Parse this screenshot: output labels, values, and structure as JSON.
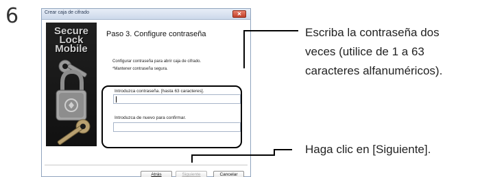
{
  "step_number": "6",
  "window": {
    "title": "Crear caja de cifrado",
    "close_glyph": "✕",
    "brand": [
      "Secure",
      "Lock",
      "Mobile"
    ],
    "step_title": "Paso 3. Configure contraseña",
    "description": [
      "Configurar contraseña para abrir caja de cifrado.",
      "*Mantener contraseña segura."
    ],
    "password_label": "Introduzca contraseña. [hasta 63 caracteres].",
    "password_value": "",
    "confirm_label": "Introduzca de nuevo para confirmar.",
    "confirm_value": "",
    "buttons": {
      "back": "Atrás",
      "next": "Siguiente",
      "cancel": "Cancelar"
    }
  },
  "callouts": {
    "password": [
      "Escriba la contraseña dos",
      "veces (utilice de 1 a 63",
      "caracteres alfanuméricos)."
    ],
    "next": "Haga clic en [Siguiente]."
  }
}
